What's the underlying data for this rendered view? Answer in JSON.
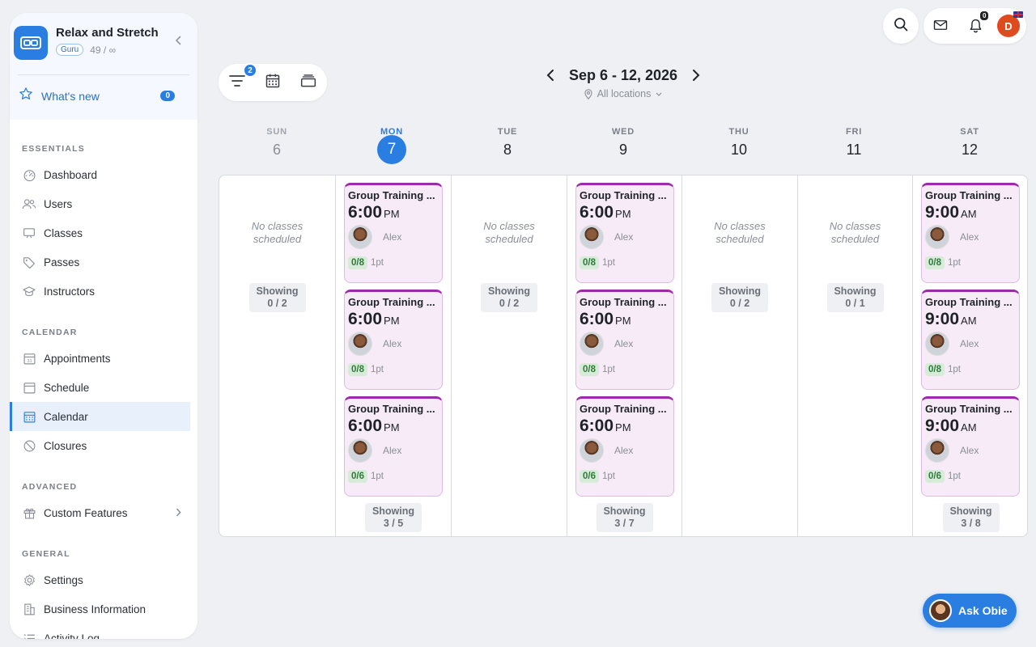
{
  "brand": {
    "name": "Relax and Stretch",
    "plan_badge": "Guru",
    "usage": "49 / ∞"
  },
  "whats_new": {
    "label": "What's new",
    "count": "0"
  },
  "sidebar": {
    "sections": [
      {
        "title": "ESSENTIALS",
        "items": [
          {
            "label": "Dashboard",
            "icon": "dashboard-icon"
          },
          {
            "label": "Users",
            "icon": "users-icon"
          },
          {
            "label": "Classes",
            "icon": "classes-icon"
          },
          {
            "label": "Passes",
            "icon": "tag-icon"
          },
          {
            "label": "Instructors",
            "icon": "instructor-icon"
          }
        ]
      },
      {
        "title": "CALENDAR",
        "items": [
          {
            "label": "Appointments",
            "icon": "calendar-31-icon"
          },
          {
            "label": "Schedule",
            "icon": "schedule-icon"
          },
          {
            "label": "Calendar",
            "icon": "calendar-grid-icon",
            "active": true
          },
          {
            "label": "Closures",
            "icon": "closure-icon"
          }
        ]
      },
      {
        "title": "ADVANCED",
        "items": [
          {
            "label": "Custom Features",
            "icon": "gift-icon",
            "has_chevron": true
          }
        ]
      },
      {
        "title": "GENERAL",
        "items": [
          {
            "label": "Settings",
            "icon": "gear-icon"
          },
          {
            "label": "Business Information",
            "icon": "building-icon"
          },
          {
            "label": "Activity Log",
            "icon": "list-icon"
          }
        ]
      }
    ]
  },
  "topbar": {
    "notification_count": "0",
    "avatar_initial": "D"
  },
  "toolbar": {
    "filter_count": "2"
  },
  "calendar": {
    "range_label": "Sep 6 - 12, 2026",
    "location_filter": "All locations",
    "days": [
      {
        "name": "SUN",
        "num": "6",
        "state": "past",
        "empty_text": "No classes scheduled",
        "showing": "Showing",
        "showing_count": "0 / 2",
        "classes": []
      },
      {
        "name": "MON",
        "num": "7",
        "state": "today",
        "showing": "Showing",
        "showing_count": "3 / 5",
        "classes": [
          {
            "title": "Group Training ...",
            "time": "6:00",
            "ampm": "PM",
            "instructor": "Alex",
            "capacity": "0/8",
            "points": "1pt"
          },
          {
            "title": "Group Training ...",
            "time": "6:00",
            "ampm": "PM",
            "instructor": "Alex",
            "capacity": "0/8",
            "points": "1pt"
          },
          {
            "title": "Group Training ...",
            "time": "6:00",
            "ampm": "PM",
            "instructor": "Alex",
            "capacity": "0/6",
            "points": "1pt"
          }
        ]
      },
      {
        "name": "TUE",
        "num": "8",
        "state": "",
        "empty_text": "No classes scheduled",
        "showing": "Showing",
        "showing_count": "0 / 2",
        "classes": []
      },
      {
        "name": "WED",
        "num": "9",
        "state": "",
        "showing": "Showing",
        "showing_count": "3 / 7",
        "classes": [
          {
            "title": "Group Training ...",
            "time": "6:00",
            "ampm": "PM",
            "instructor": "Alex",
            "capacity": "0/8",
            "points": "1pt"
          },
          {
            "title": "Group Training ...",
            "time": "6:00",
            "ampm": "PM",
            "instructor": "Alex",
            "capacity": "0/8",
            "points": "1pt"
          },
          {
            "title": "Group Training ...",
            "time": "6:00",
            "ampm": "PM",
            "instructor": "Alex",
            "capacity": "0/6",
            "points": "1pt"
          }
        ]
      },
      {
        "name": "THU",
        "num": "10",
        "state": "",
        "empty_text": "No classes scheduled",
        "showing": "Showing",
        "showing_count": "0 / 2",
        "classes": []
      },
      {
        "name": "FRI",
        "num": "11",
        "state": "",
        "empty_text": "No classes scheduled",
        "showing": "Showing",
        "showing_count": "0 / 1",
        "classes": []
      },
      {
        "name": "SAT",
        "num": "12",
        "state": "",
        "showing": "Showing",
        "showing_count": "3 / 8",
        "classes": [
          {
            "title": "Group Training ...",
            "time": "9:00",
            "ampm": "AM",
            "instructor": "Alex",
            "capacity": "0/8",
            "points": "1pt"
          },
          {
            "title": "Group Training ...",
            "time": "9:00",
            "ampm": "AM",
            "instructor": "Alex",
            "capacity": "0/8",
            "points": "1pt"
          },
          {
            "title": "Group Training ...",
            "time": "9:00",
            "ampm": "AM",
            "instructor": "Alex",
            "capacity": "0/6",
            "points": "1pt"
          }
        ]
      }
    ]
  },
  "assistant": {
    "label": "Ask Obie"
  },
  "colors": {
    "accent": "#2a7de1",
    "class_card_bg": "#f7ebf8",
    "class_card_top": "#9b2ba8",
    "capacity_bg": "#d7ebd9"
  }
}
